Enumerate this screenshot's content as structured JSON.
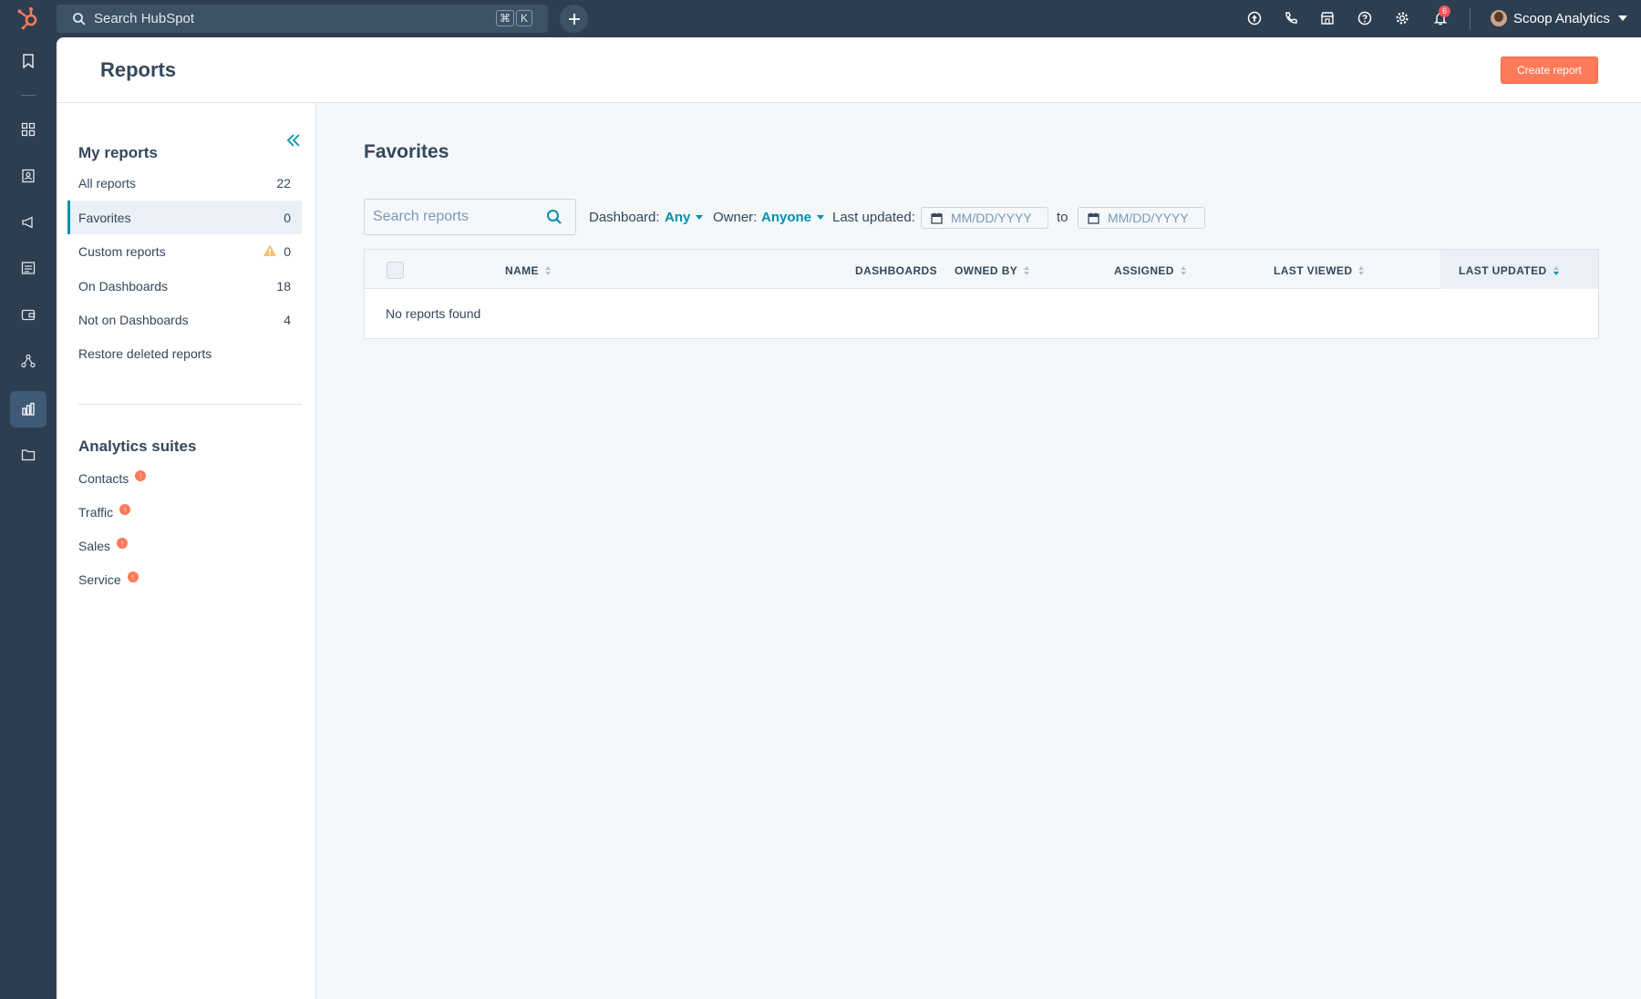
{
  "topbar": {
    "search_placeholder": "Search HubSpot",
    "shortcut_keys": [
      "⌘",
      "K"
    ],
    "notification_count": "6",
    "account_name": "Scoop Analytics"
  },
  "page": {
    "title": "Reports",
    "create_button": "Create report"
  },
  "sidebar": {
    "my_reports_heading": "My reports",
    "items": [
      {
        "label": "All reports",
        "count": "22"
      },
      {
        "label": "Favorites",
        "count": "0"
      },
      {
        "label": "Custom reports",
        "count": "0"
      },
      {
        "label": "On Dashboards",
        "count": "18"
      },
      {
        "label": "Not on Dashboards",
        "count": "4"
      },
      {
        "label": "Restore deleted reports",
        "count": ""
      }
    ],
    "suites_heading": "Analytics suites",
    "suites": [
      {
        "label": "Contacts"
      },
      {
        "label": "Traffic"
      },
      {
        "label": "Sales"
      },
      {
        "label": "Service"
      }
    ]
  },
  "main": {
    "section_title": "Favorites",
    "search_placeholder": "Search reports",
    "filters": {
      "dashboard_label": "Dashboard:",
      "dashboard_value": "Any",
      "owner_label": "Owner:",
      "owner_value": "Anyone",
      "updated_label": "Last updated:",
      "from_placeholder": "MM/DD/YYYY",
      "to_label": "to",
      "to_placeholder": "MM/DD/YYYY"
    },
    "table": {
      "columns": [
        "NAME",
        "DASHBOARDS",
        "OWNED BY",
        "ASSIGNED",
        "LAST VIEWED",
        "LAST UPDATED"
      ],
      "sorted_column": "LAST UPDATED",
      "empty_message": "No reports found"
    }
  },
  "colors": {
    "nav_bg": "#2d3e50",
    "accent": "#0091ae",
    "primary_button": "#ff7a59",
    "text": "#33475b"
  }
}
